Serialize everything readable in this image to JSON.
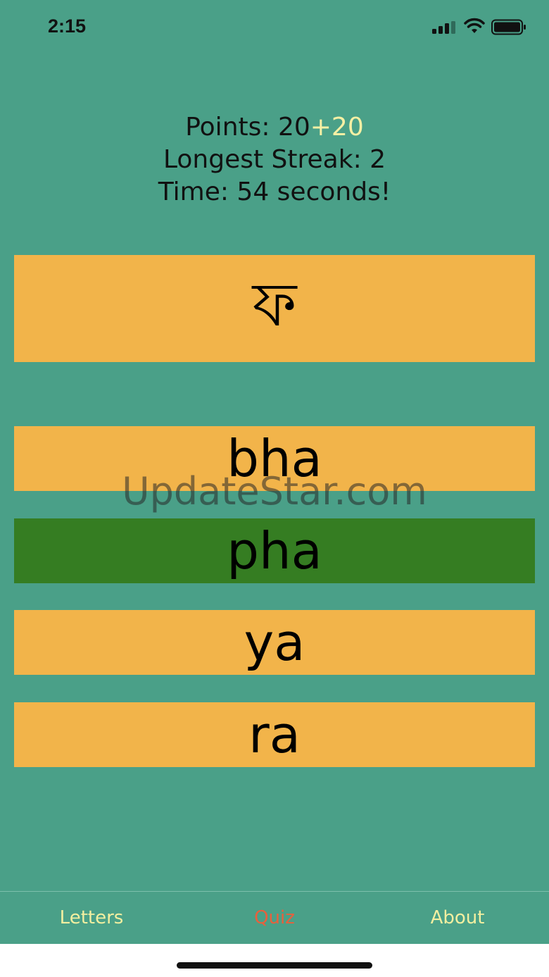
{
  "status_bar": {
    "time": "2:15",
    "signal_icon": "cellular-signal-icon",
    "wifi_icon": "wifi-icon",
    "battery_icon": "battery-icon"
  },
  "stats": {
    "points_label": "Points: ",
    "points_value": "20",
    "points_bonus": "+20",
    "streak_text": "Longest Streak: 2",
    "time_text": "Time: 54 seconds!"
  },
  "quiz": {
    "letter": "ফ",
    "answers": [
      {
        "label": "bha",
        "state": "default"
      },
      {
        "label": "pha",
        "state": "correct"
      },
      {
        "label": "ya",
        "state": "default"
      },
      {
        "label": "ra",
        "state": "default"
      }
    ]
  },
  "watermark": "UpdateStar.com",
  "tab_bar": {
    "tabs": [
      {
        "label": "Letters",
        "active": false
      },
      {
        "label": "Quiz",
        "active": true
      },
      {
        "label": "About",
        "active": false
      }
    ]
  },
  "colors": {
    "background": "#4aa088",
    "card": "#f2b44a",
    "correct": "#357d22",
    "tab_inactive": "#f2efa0",
    "tab_active": "#e8603c",
    "bonus": "#f6f0a4"
  }
}
